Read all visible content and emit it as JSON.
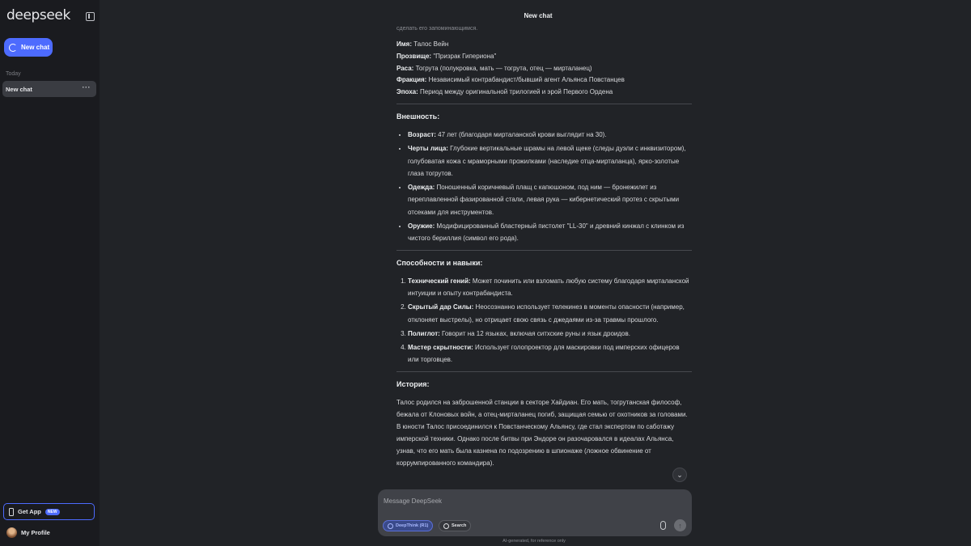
{
  "sidebar": {
    "logo": "deepseek",
    "new_chat_label": "New chat",
    "section_today": "Today",
    "chat_items": [
      {
        "label": "New chat",
        "more": "···"
      }
    ],
    "get_app_label": "Get App",
    "get_app_badge": "NEW",
    "profile_label": "My Profile",
    "accent_color": "#4d6bfe"
  },
  "header": {
    "title": "New chat"
  },
  "message": {
    "faded_top": "сделать его запоминающимся.",
    "info": [
      {
        "label": "Имя:",
        "value": " Талос Вейн"
      },
      {
        "label": "Прозвище:",
        "value": " \"Призрак Гипериона\""
      },
      {
        "label": "Раса:",
        "value": " Тогрута (полукровка, мать — тогрута, отец — мирталанец)"
      },
      {
        "label": "Фракция:",
        "value": " Независимый контрабандист/бывший агент Альянса Повстанцев"
      },
      {
        "label": "Эпоха:",
        "value": " Период между оригинальной трилогией и эрой Первого Ордена"
      }
    ],
    "appearance": {
      "heading": "Внешность:",
      "items": [
        {
          "label": "Возраст:",
          "value": " 47 лет (благодаря мирталанской крови выглядит на 30)."
        },
        {
          "label": "Черты лица:",
          "value": " Глубокие вертикальные шрамы на левой щеке (следы дуэли с инквизитором), голубоватая кожа с мраморными прожилками (наследие отца-мирталанца), ярко-золотые глаза тогрутов."
        },
        {
          "label": "Одежда:",
          "value": " Поношенный коричневый плащ с капюшоном, под ним — бронежилет из переплавленной фазированной стали, левая рука — кибернетический протез с скрытыми отсеками для инструментов."
        },
        {
          "label": "Оружие:",
          "value": " Модифицированный бластерный пистолет \"LL-30\" и древний кинжал с клинком из чистого бериллия (символ его рода)."
        }
      ]
    },
    "skills": {
      "heading": "Способности и навыки:",
      "items": [
        {
          "label": "Технический гений:",
          "value": " Может починить или взломать любую систему благодаря мирталанской интуиции и опыту контрабандиста."
        },
        {
          "label": "Скрытый дар Силы:",
          "value": " Неосознанно использует телекинез в моменты опасности (например, отклоняет выстрелы), но отрицает свою связь с джедаями из-за травмы прошлого."
        },
        {
          "label": "Полиглот:",
          "value": " Говорит на 12 языках, включая ситхские руны и язык дроидов."
        },
        {
          "label": "Мастер скрытности:",
          "value": " Использует голопроектор для маскировки под имперских офицеров или торговцев."
        }
      ]
    },
    "history": {
      "heading": "История:",
      "text": "Талос родился на заброшенной станции в секторе Хайдиан. Его мать, тогрутанская философ, бежала от Клоновых войн, а отец-мирталанец погиб, защищая семью от охотников за головами. В юности Талос присоединился к Повстанческому Альянсу, где стал экспертом по саботажу имперской техники. Однако после битвы при Эндоре он разочаровался в идеалах Альянса, узнав, что его мать была казнена по подозрению в шпионаже (ложное обвинение от коррумпированного командира)."
    }
  },
  "composer": {
    "placeholder": "Message DeepSeek",
    "deepthink_label": "DeepThink (R1)",
    "search_label": "Search",
    "send_icon": "↑"
  },
  "disclaimer": "AI-generated, for reference only",
  "icons": {
    "collapse": "sidebar-collapse-icon",
    "new_chat": "new-chat-icon",
    "scroll_down": "chevron-down-icon"
  }
}
